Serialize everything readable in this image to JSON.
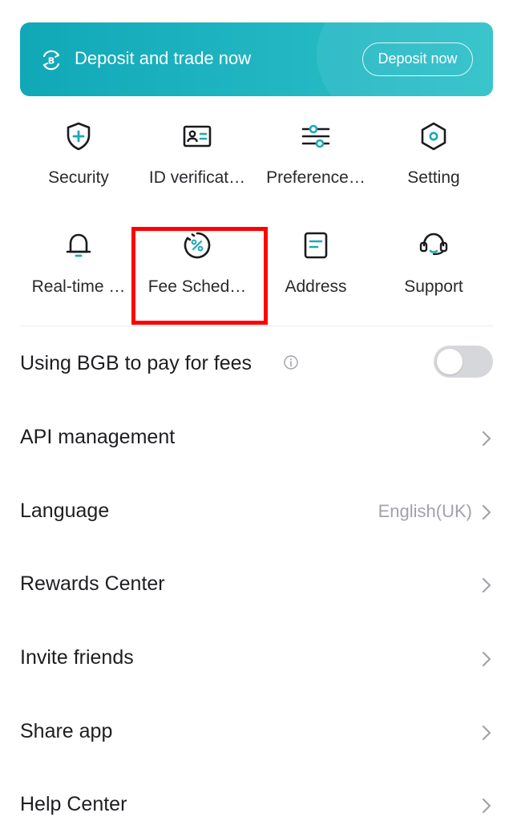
{
  "banner": {
    "title": "Deposit and trade now",
    "button_label": "Deposit now",
    "icon": "bitcoin-exchange-icon"
  },
  "shortcuts": [
    {
      "label": "Security",
      "icon": "shield-plus-icon"
    },
    {
      "label": "ID verificat…",
      "icon": "id-card-icon"
    },
    {
      "label": "Preference…",
      "icon": "sliders-icon"
    },
    {
      "label": "Setting",
      "icon": "hexagon-gear-icon"
    },
    {
      "label": "Real-time …",
      "icon": "bell-icon"
    },
    {
      "label": "Fee Sched…",
      "icon": "percent-circle-icon"
    },
    {
      "label": "Address",
      "icon": "document-icon"
    },
    {
      "label": "Support",
      "icon": "headset-icon"
    }
  ],
  "settings": {
    "bgb_fees": {
      "label": "Using BGB to pay for fees",
      "enabled": false
    },
    "api": {
      "label": "API management"
    },
    "language": {
      "label": "Language",
      "value": "English(UK)"
    },
    "rewards": {
      "label": "Rewards Center"
    },
    "invite": {
      "label": "Invite friends"
    },
    "share": {
      "label": "Share app"
    },
    "help": {
      "label": "Help Center"
    }
  },
  "colors": {
    "accent": "#1ba9b8",
    "icon_stroke": "#1a1a1f",
    "highlight": "#ff0000",
    "muted_text": "#a0a3aa"
  }
}
